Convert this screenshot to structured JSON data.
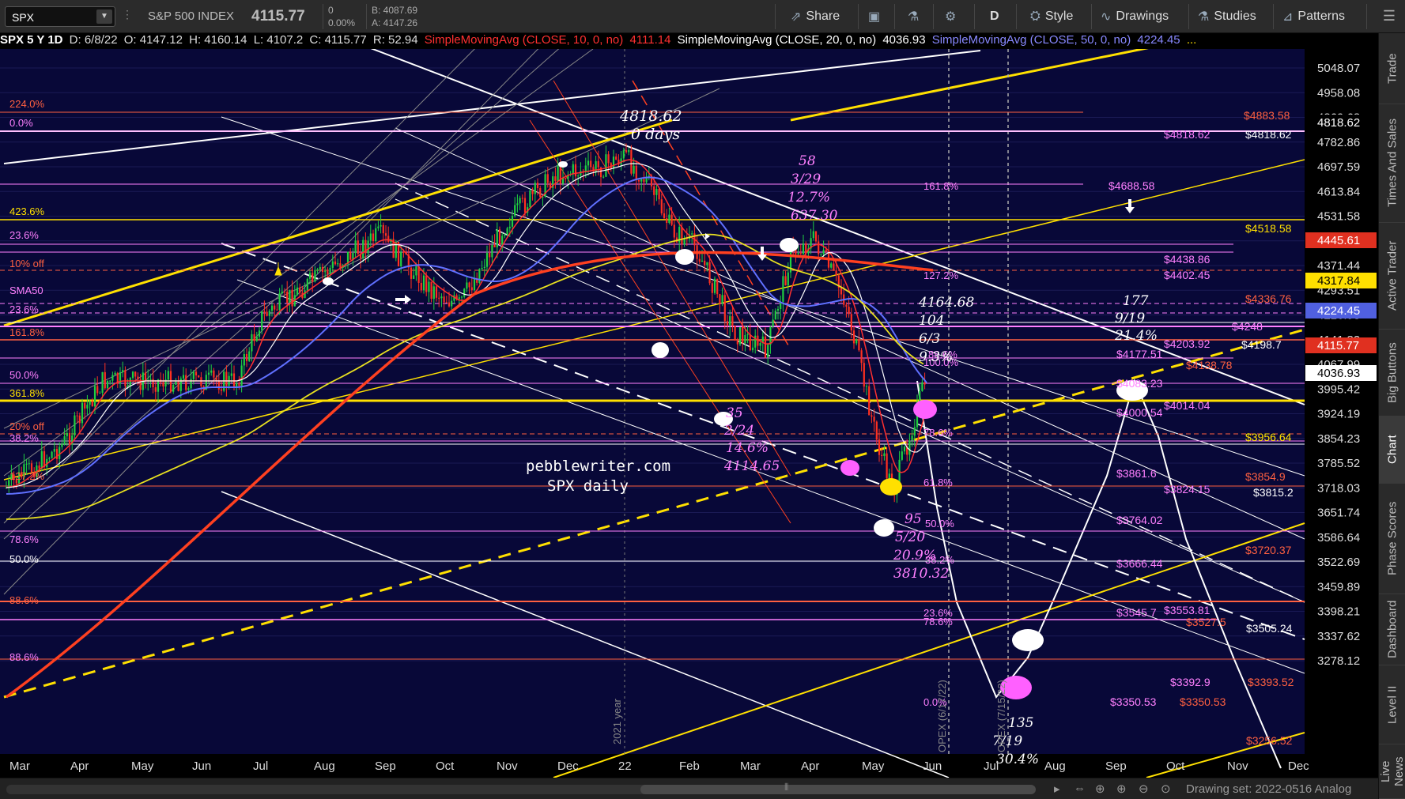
{
  "toolbar": {
    "symbol": "SPX",
    "description": "S&P 500 INDEX",
    "last": "4115.77",
    "change": "0",
    "change_pct": "0.00%",
    "bid": "B: 4087.69",
    "ask": "A: 4147.26",
    "share": "Share",
    "aggregation": "D",
    "style": "Style",
    "drawings": "Drawings",
    "studies": "Studies",
    "patterns": "Patterns"
  },
  "studybar": {
    "title": "SPX 5 Y 1D",
    "date": "D: 6/8/22",
    "open": "O: 4147.12",
    "high": "H: 4160.14",
    "low": "L: 4107.2",
    "close": "C: 4115.77",
    "range": "R: 52.94",
    "sma10": "SimpleMovingAvg (CLOSE, 10, 0, no)",
    "sma10_val": "4111.14",
    "sma20": "SimpleMovingAvg (CLOSE, 20, 0, no)",
    "sma20_val": "4036.93",
    "sma50": "SimpleMovingAvg (CLOSE, 50, 0, no)",
    "sma50_val": "4224.45",
    "more": "..."
  },
  "price_axis": {
    "ticks": [
      "5048.07",
      "4958.08",
      "4869.68",
      "4782.86",
      "4697.59",
      "4613.84",
      "4531.58",
      "4450.79",
      "4371.44",
      "4293.51",
      "4216.98",
      "4141.82",
      "4067.99",
      "3995.42",
      "3924.19",
      "3854.23",
      "3785.52",
      "3718.03",
      "3651.74",
      "3586.64",
      "3522.69",
      "3459.89",
      "3398.21",
      "3337.62",
      "3278.12"
    ],
    "tags": [
      {
        "text": "4818.62",
        "bg": "#000000",
        "fg": "#ffffff"
      },
      {
        "text": "4445.61",
        "bg": "#e03020",
        "fg": "#ffffff"
      },
      {
        "text": "4317.84",
        "bg": "#ffe000",
        "fg": "#000000"
      },
      {
        "text": "4224.45",
        "bg": "#5060e0",
        "fg": "#ffffff"
      },
      {
        "text": "4115.77",
        "bg": "#e03020",
        "fg": "#ffffff"
      },
      {
        "text": "4036.93",
        "bg": "#ffffff",
        "fg": "#000000"
      }
    ]
  },
  "time_axis": {
    "labels": [
      "Mar",
      "Apr",
      "May",
      "Jun",
      "Jul",
      "Aug",
      "Sep",
      "Oct",
      "Nov",
      "Dec",
      "22",
      "Feb",
      "Mar",
      "Apr",
      "May",
      "Jun",
      "Jul",
      "Aug",
      "Sep",
      "Oct",
      "Nov",
      "Dec"
    ]
  },
  "annotations": {
    "watermark1": "pebblewriter.com",
    "watermark2": "SPX daily",
    "top_price": "4818.62",
    "top_days": "0 days",
    "a58": [
      "58",
      "3/29",
      "12.7%",
      "637.30"
    ],
    "a35": [
      "35",
      "2/24",
      "14.6%",
      "4114.65"
    ],
    "a95": [
      "95",
      "5/20",
      "20.9%",
      "3810.32"
    ],
    "a104": [
      "4164.68",
      "104",
      "6/3",
      "9.3%"
    ],
    "a177": [
      "177",
      "9/19",
      "21.4%"
    ],
    "a135": [
      "135",
      "7/19",
      "30.4%"
    ],
    "year_label": "2021 year",
    "opex1": "OPEX (6/17/22)",
    "opex2": "OPEX (7/15/22)"
  },
  "left_labels": [
    {
      "text": "224.0%",
      "color": "#ff6040"
    },
    {
      "text": "0.0%",
      "color": "#ff80ff"
    },
    {
      "text": "423.6%",
      "color": "#ffe000"
    },
    {
      "text": "23.6%",
      "color": "#ff80ff"
    },
    {
      "text": "10% off",
      "color": "#ff6040"
    },
    {
      "text": "SMA50",
      "color": "#ff80ff"
    },
    {
      "text": "23.6%",
      "color": "#ff80ff"
    },
    {
      "text": "161.8%",
      "color": "#ff6040"
    },
    {
      "text": "50.0%",
      "color": "#ff80ff"
    },
    {
      "text": "361.8%",
      "color": "#ffe000"
    },
    {
      "text": "20% off",
      "color": "#ff6040"
    },
    {
      "text": "38.2%",
      "color": "#ff80ff"
    },
    {
      "text": "127.2%",
      "color": "#ff6040"
    },
    {
      "text": "78.6%",
      "color": "#ff80ff"
    },
    {
      "text": "50.0%",
      "color": "#ffffff"
    },
    {
      "text": "88.6%",
      "color": "#ff6040"
    },
    {
      "text": "88.6%",
      "color": "#ff80ff"
    }
  ],
  "right_labels": [
    {
      "text": "$4883.58",
      "color": "#ff6040"
    },
    {
      "text": "$4818.62",
      "color": "#ff80ff"
    },
    {
      "text": "$4818.62",
      "color": "#ffffff"
    },
    {
      "text": "$4688.58",
      "color": "#ff80ff"
    },
    {
      "text": "$4518.58",
      "color": "#ffe000"
    },
    {
      "text": "$4438.86",
      "color": "#ff80ff"
    },
    {
      "text": "$4402.45",
      "color": "#ff80ff"
    },
    {
      "text": "$4336.76",
      "color": "#ff6040"
    },
    {
      "text": "$4248",
      "color": "#ff80ff"
    },
    {
      "text": "$4203.92",
      "color": "#ff80ff"
    },
    {
      "text": "$4198.7",
      "color": "#ffffff"
    },
    {
      "text": "$4177.51",
      "color": "#ff80ff"
    },
    {
      "text": "$4138.78",
      "color": "#ff6040"
    },
    {
      "text": "$4083.23",
      "color": "#ff80ff"
    },
    {
      "text": "$4014.04",
      "color": "#ff80ff"
    },
    {
      "text": "$4000.54",
      "color": "#ff80ff"
    },
    {
      "text": "$3956.64",
      "color": "#ffe000"
    },
    {
      "text": "$3861.6",
      "color": "#ff80ff"
    },
    {
      "text": "$3854.9",
      "color": "#ff6040"
    },
    {
      "text": "$3824.15",
      "color": "#ff80ff"
    },
    {
      "text": "$3815.2",
      "color": "#ffffff"
    },
    {
      "text": "$3764.02",
      "color": "#ff80ff"
    },
    {
      "text": "$3720.37",
      "color": "#ff6040"
    },
    {
      "text": "$3666.44",
      "color": "#ff80ff"
    },
    {
      "text": "$3545.7",
      "color": "#ff80ff"
    },
    {
      "text": "$3553.81",
      "color": "#ff80ff"
    },
    {
      "text": "$3527.5",
      "color": "#ff6040"
    },
    {
      "text": "$3505.24",
      "color": "#ffffff"
    },
    {
      "text": "$3392.9",
      "color": "#ff80ff"
    },
    {
      "text": "$3393.52",
      "color": "#ff6040"
    },
    {
      "text": "$3350.53",
      "color": "#ff80ff"
    },
    {
      "text": "$3350.53",
      "color": "#ff6040"
    },
    {
      "text": "$3256.52",
      "color": "#ff6040"
    }
  ],
  "fib_labels": [
    {
      "text": "161.8%"
    },
    {
      "text": "127.2%"
    },
    {
      "text": "100.0%"
    },
    {
      "text": "88.6%"
    },
    {
      "text": "78.6%"
    },
    {
      "text": "61.8%"
    },
    {
      "text": "50.0%"
    },
    {
      "text": "38.2%"
    },
    {
      "text": "23.6%"
    },
    {
      "text": "78.6%"
    },
    {
      "text": "0.0%"
    }
  ],
  "sidebar": [
    "Trade",
    "Times And Sales",
    "Active Trader",
    "Big Buttons",
    "Chart",
    "Phase Scores",
    "Dashboard",
    "Level II",
    "Live News"
  ],
  "bottombar": {
    "drawing_set": "Drawing set: 2022-0516 Analog"
  }
}
